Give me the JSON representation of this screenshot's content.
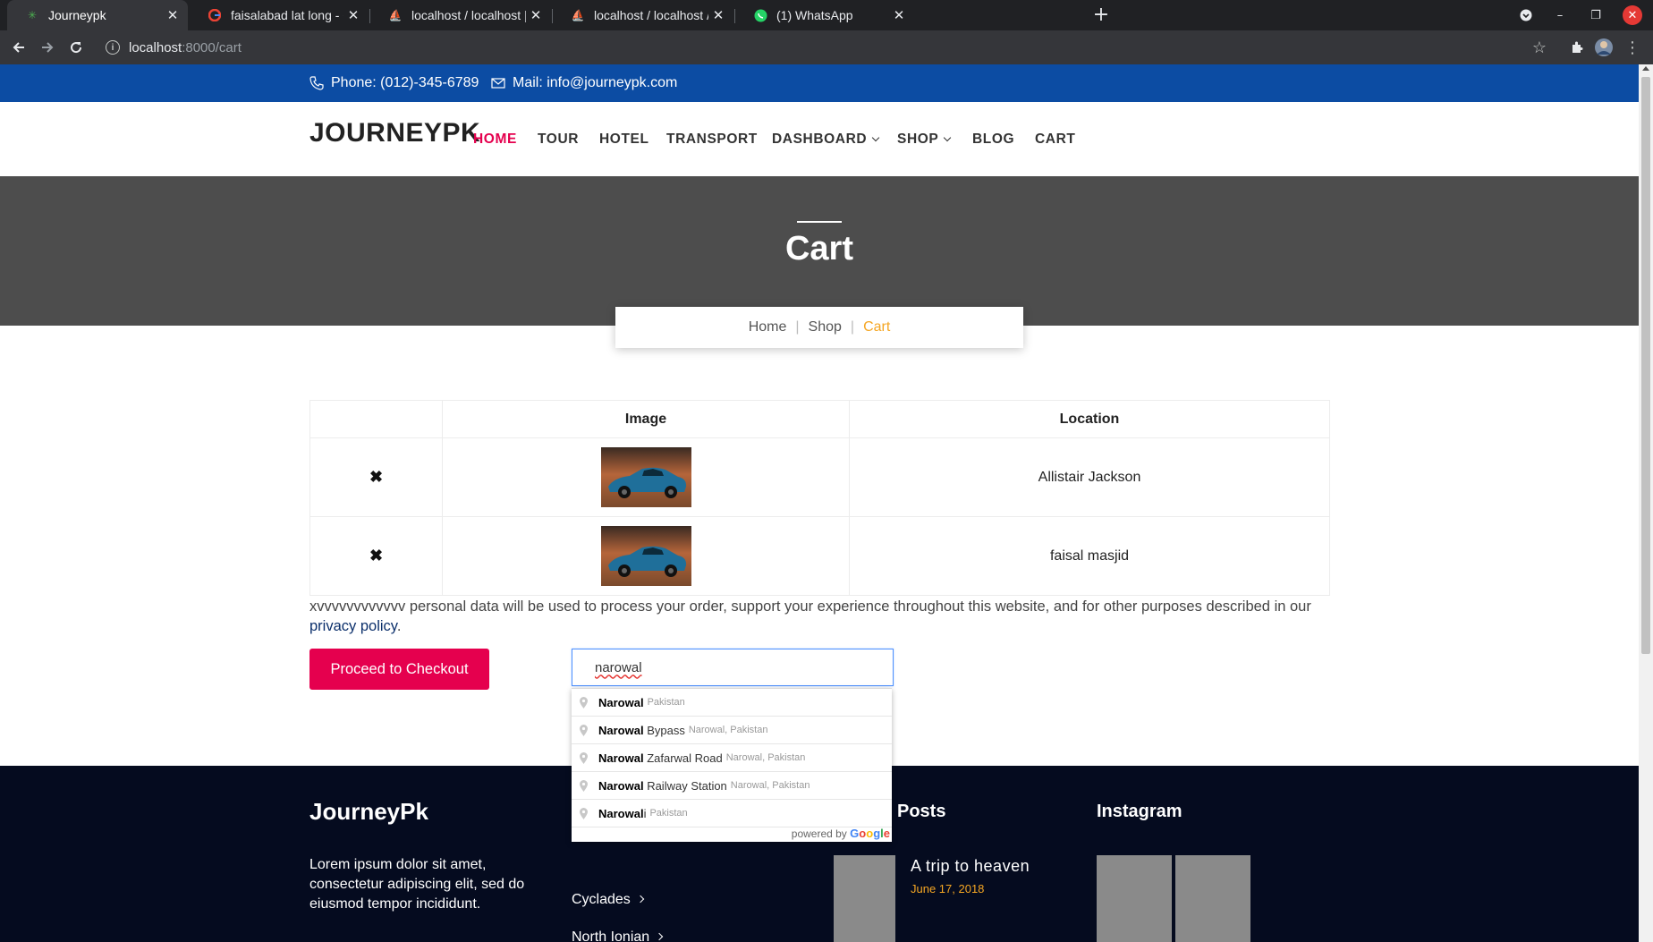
{
  "browser": {
    "tabs": [
      {
        "title": "Journeypk",
        "icon": "site-icon",
        "active": true
      },
      {
        "title": "faisalabad lat long - Goog",
        "icon": "google-icon",
        "active": false
      },
      {
        "title": "localhost / localhost | php",
        "icon": "phpmyadmin-icon",
        "active": false
      },
      {
        "title": "localhost / localhost / jou",
        "icon": "phpmyadmin-icon",
        "active": false
      },
      {
        "title": "(1) WhatsApp",
        "icon": "whatsapp-icon",
        "active": false
      }
    ],
    "new_tab": "+",
    "url_host": "localhost",
    "url_path": ":8000/cart"
  },
  "topbar": {
    "phone": "Phone: (012)-345-6789",
    "mail": "Mail: info@journeypk.com"
  },
  "header": {
    "logo": "JOURNEYPK",
    "nav": [
      "HOME",
      "TOUR",
      "HOTEL",
      "TRANSPORT",
      "DASHBOARD",
      "SHOP",
      "BLOG",
      "CART"
    ]
  },
  "hero": {
    "title": "Cart"
  },
  "breadcrumb": {
    "home": "Home",
    "sep": "|",
    "shop": "Shop",
    "current": "Cart"
  },
  "cart": {
    "headers": [
      "",
      "Image",
      "Location"
    ],
    "rows": [
      {
        "remove": "✖",
        "location": "Allistair Jackson"
      },
      {
        "remove": "✖",
        "location": "faisal masjid"
      }
    ]
  },
  "note": {
    "text": "xvvvvvvvvvvvv personal data will be used to process your order, support your experience throughout this website, and for other purposes described in our ",
    "link": "privacy policy",
    "end": "."
  },
  "checkout": {
    "label": "Proceed to Checkout"
  },
  "location_search": {
    "value": "narowal",
    "suggestions": [
      {
        "match": "Narowal",
        "rest": "",
        "secondary": "Pakistan"
      },
      {
        "match": "Narowal",
        "rest": " Bypass",
        "secondary": "Narowal, Pakistan"
      },
      {
        "match": "Narowal",
        "rest": " Zafarwal Road",
        "secondary": "Narowal, Pakistan"
      },
      {
        "match": "Narowal",
        "rest": " Railway Station",
        "secondary": "Narowal, Pakistan"
      },
      {
        "match": "Narowal",
        "rest": "i",
        "secondary": "Pakistan"
      }
    ],
    "powered_by": "powered by",
    "google": "Google"
  },
  "footer": {
    "brand": "JourneyPk",
    "about": "Lorem ipsum dolor sit amet, consectetur adipiscing elit, sed do eiusmod tempor incididunt.",
    "links": [
      "Cyclades",
      "North Ionian"
    ],
    "posts_heading": "Posts",
    "instagram_heading": "Instagram",
    "post": {
      "title": "A trip to heaven",
      "date": "June 17, 2018"
    }
  },
  "colors": {
    "topbar": "#0c4ca3",
    "accent": "#e5004e",
    "hero": "#4d4d4d",
    "breadcrumb_current": "#f5a623",
    "footer": "#050b1f"
  }
}
